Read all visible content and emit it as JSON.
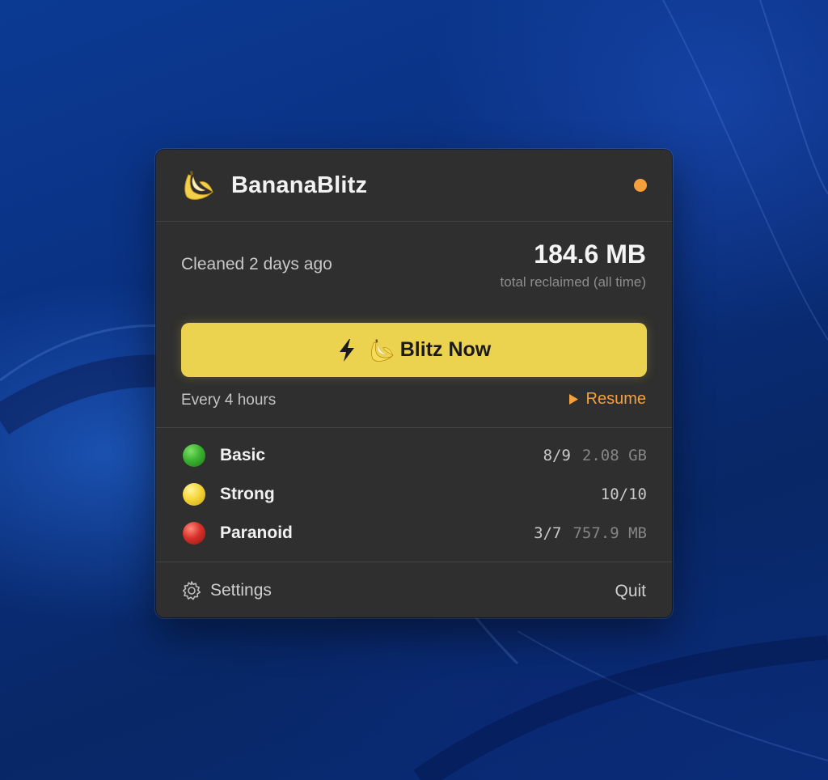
{
  "app": {
    "name": "BananaBlitz",
    "logo_icon": "banana-icon",
    "status_color": "#f6a03b"
  },
  "stats": {
    "last_cleaned": "Cleaned 2 days ago",
    "reclaimed_value": "184.6 MB",
    "reclaimed_caption": "total reclaimed (all time)"
  },
  "action": {
    "label": "Blitz Now",
    "icons": [
      "bolt-icon",
      "banana-icon"
    ],
    "color": "#ecd34f"
  },
  "schedule": {
    "interval_text": "Every 4 hours",
    "resume_label": "Resume",
    "accent_color": "#f6a03b"
  },
  "levels": [
    {
      "name": "Basic",
      "count": "8/9",
      "size": "2.08 GB",
      "color": "#3bb330"
    },
    {
      "name": "Strong",
      "count": "10/10",
      "size": "",
      "color": "#f5d63a"
    },
    {
      "name": "Paranoid",
      "count": "3/7",
      "size": "757.9 MB",
      "color": "#d8312b"
    }
  ],
  "footer": {
    "settings_label": "Settings",
    "quit_label": "Quit"
  }
}
